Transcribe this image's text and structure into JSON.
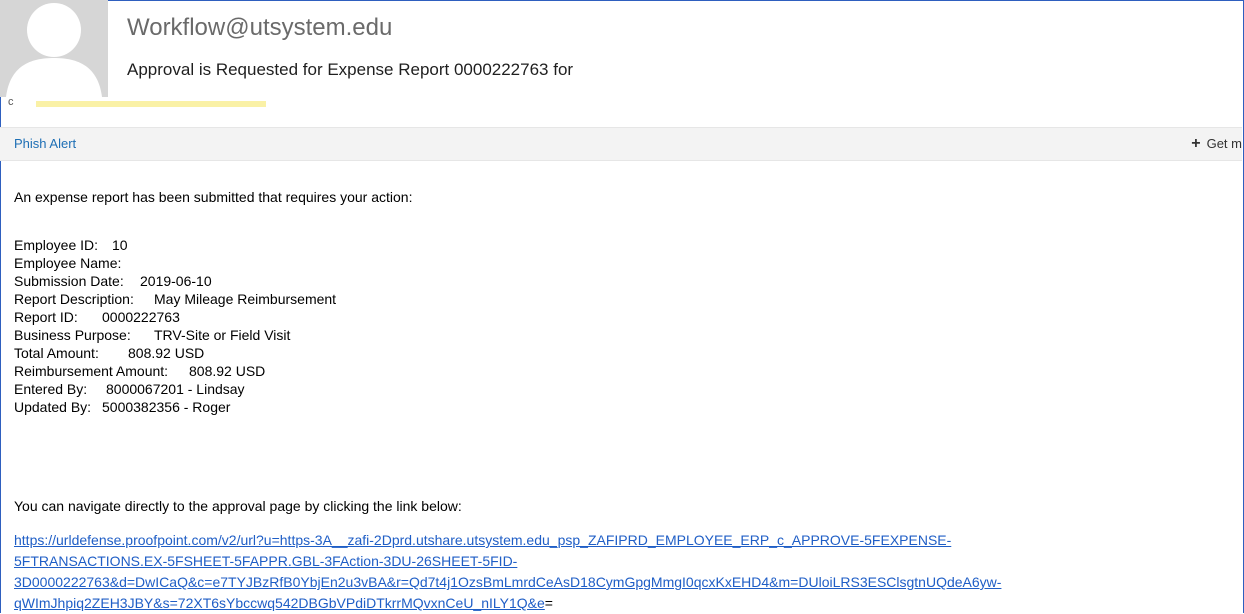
{
  "email": {
    "sender": "Workflow@utsystem.edu",
    "subject": "Approval is Requested for Expense Report 0000222763 for",
    "recipient_stub": "c"
  },
  "toolbar": {
    "phish_alert_label": "Phish Alert",
    "get_more_label": "Get m",
    "get_more_icon": "plus-icon"
  },
  "body": {
    "intro": "An expense report has been submitted that requires your action:",
    "fields": [
      {
        "label": "Employee ID:",
        "value": "10"
      },
      {
        "label": "Employee Name:",
        "value": ""
      },
      {
        "label": "Submission Date:",
        "value": "2019-06-10"
      },
      {
        "label": "Report Description:",
        "value": "May Mileage Reimbursement"
      },
      {
        "label": "Report ID:",
        "value": "0000222763"
      },
      {
        "label": "Business Purpose:",
        "value": "TRV-Site or Field Visit"
      },
      {
        "label": "Total Amount:",
        "value": "808.92 USD"
      },
      {
        "label": "Reimbursement Amount:",
        "value": "808.92 USD"
      },
      {
        "label": "Entered By:",
        "value": "8000067201 - Lindsay"
      },
      {
        "label": "Updated By:",
        "value": "5000382356 - Roger"
      }
    ],
    "navigate_text": "You can navigate directly to the approval page by clicking the link below:",
    "link_lines": [
      "https://urldefense.proofpoint.com/v2/url?u=https-3A__zafi-2Dprd.utshare.utsystem.edu_psp_ZAFIPRD_EMPLOYEE_ERP_c_APPROVE-5FEXPENSE-",
      "5FTRANSACTIONS.EX-5FSHEET-5FAPPR.GBL-3FAction-3DU-26SHEET-5FID-",
      "3D0000222763&d=DwICaQ&c=e7TYJBzRfB0YbjEn2u3vBA&r=Qd7t4j1OzsBmLmrdCeAsD18CymGpgMmgI0qcxKxEHD4&m=DUloiLRS3ESClsgtnUQdeA6yw-",
      "qWImJhpiq2ZEH3JBY&s=72XT6sYbccwq542DBGbVPdiDTkrrMQvxnCeU_nILY1Q&e"
    ],
    "link_trailing": "="
  }
}
